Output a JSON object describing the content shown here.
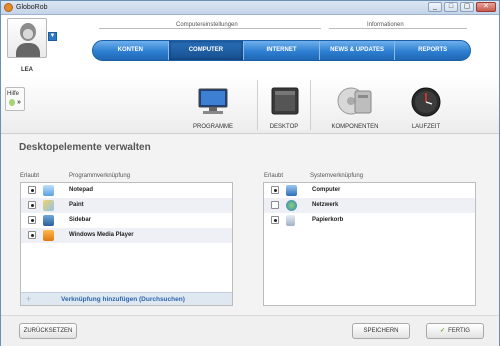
{
  "window": {
    "title": "GloboRob",
    "controls": [
      "_",
      "□",
      "▢",
      "✕"
    ]
  },
  "user": {
    "name": "LEA"
  },
  "nav": {
    "groups": [
      "Computereinstellungen",
      "Informationen"
    ],
    "items": [
      "KONTEN",
      "COMPUTER",
      "INTERNET",
      "NEWS & UPDATES",
      "REPORTS"
    ],
    "active": "COMPUTER"
  },
  "help": {
    "label": "Hilfe",
    "arrow": "»"
  },
  "categories": [
    "PROGRAMME",
    "DESKTOP",
    "KOMPONENTEN",
    "LAUFZEIT"
  ],
  "section_title": "Desktopelemente verwalten",
  "left_panel": {
    "col_allowed": "Erlaubt",
    "col_name": "Programmverknüpfung",
    "rows": [
      {
        "label": "Notepad",
        "checked": true
      },
      {
        "label": "Paint",
        "checked": true
      },
      {
        "label": "Sidebar",
        "checked": true
      },
      {
        "label": "Windows Media Player",
        "checked": true
      }
    ],
    "add_label": "Verknüpfung hinzufügen (Durchsuchen)"
  },
  "right_panel": {
    "col_allowed": "Erlaubt",
    "col_name": "Systemverknüpfung",
    "rows": [
      {
        "label": "Computer",
        "checked": true
      },
      {
        "label": "Netzwerk",
        "checked": false
      },
      {
        "label": "Papierkorb",
        "checked": true
      }
    ]
  },
  "buttons": {
    "reset": "ZURÜCKSETZEN",
    "save": "SPEICHERN",
    "done": "FERTIG",
    "check_mark": "✓"
  },
  "colors": {
    "accent": "#2d7fd1",
    "link": "#2b66ad",
    "success": "#6aa53b"
  }
}
